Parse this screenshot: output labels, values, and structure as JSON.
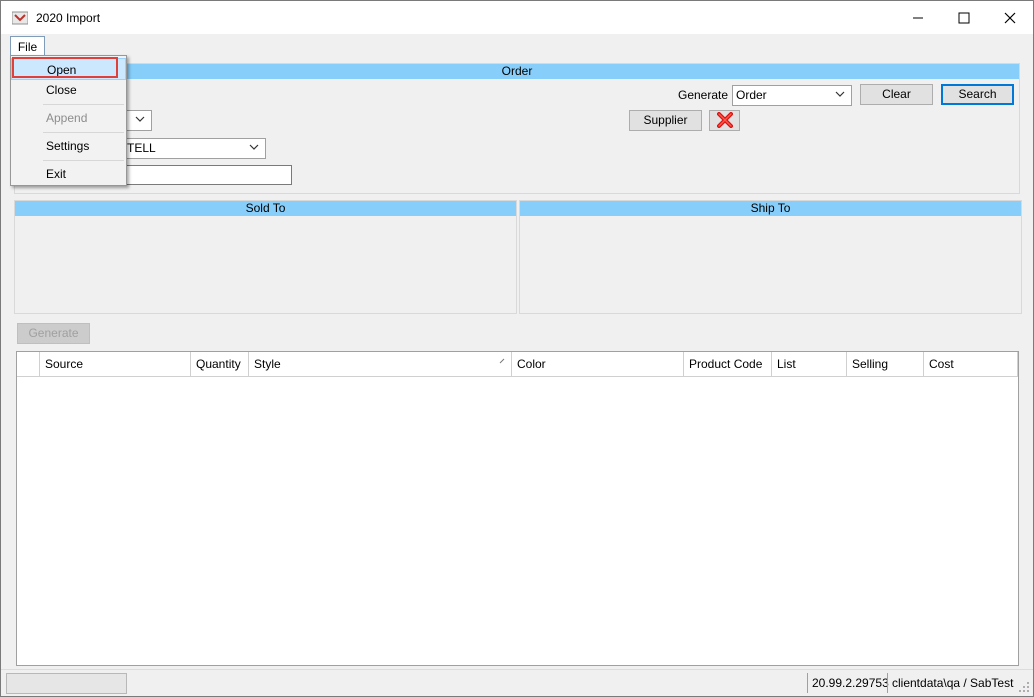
{
  "window": {
    "title": "2020 Import",
    "controls": {
      "minimize": "minimize-icon",
      "maximize": "maximize-icon",
      "close": "close-icon"
    }
  },
  "menubar": {
    "file_label": "File"
  },
  "file_menu": {
    "items": [
      {
        "label": "Open",
        "state": "highlighted"
      },
      {
        "label": "Close",
        "state": "normal"
      },
      {
        "label": "Append",
        "state": "disabled"
      },
      {
        "label": "Settings",
        "state": "normal"
      },
      {
        "label": "Exit",
        "state": "normal"
      }
    ]
  },
  "order_panel": {
    "header": "Order",
    "generate_label": "Generate",
    "generate_value": "Order",
    "clear_label": "Clear",
    "search_label": "Search",
    "supplier_label": "Supplier",
    "delete_icon": "red-x-icon",
    "partial_combo_value": "TELL"
  },
  "sold_to": {
    "header": "Sold To"
  },
  "ship_to": {
    "header": "Ship To"
  },
  "generate_button": {
    "label": "Generate"
  },
  "grid": {
    "columns": [
      "Source",
      "Quantity",
      "Style",
      "Color",
      "Product Code",
      "List",
      "Selling",
      "Cost"
    ]
  },
  "status": {
    "version": "20.99.2.29753",
    "connection": "clientdata\\qa / SabTest"
  },
  "colors": {
    "panel_header": "#87cefa",
    "focus_border": "#0078d7",
    "annotation_red": "#e0403a",
    "menu_highlight": "#cce8ff"
  }
}
